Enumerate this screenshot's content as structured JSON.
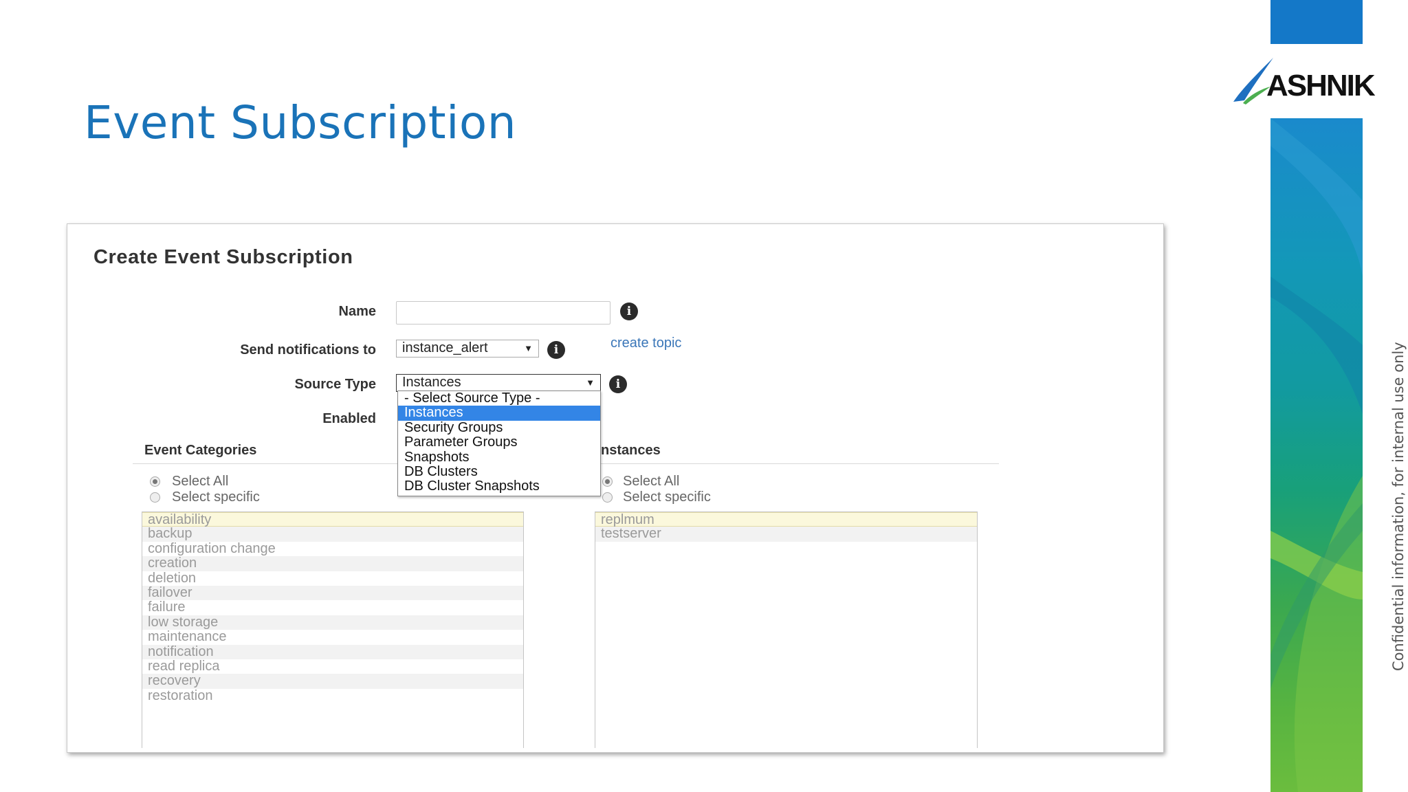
{
  "slide": {
    "title": "Event Subscription",
    "confidential_note": "Confidential information, for internal use only"
  },
  "logo": {
    "text": "ASHNIK"
  },
  "colors": {
    "title_blue": "#1a73b8",
    "link_blue": "#3a76b8",
    "dropdown_selected": "#3385e6",
    "strip_top": "#1478c8",
    "strip_bottom": "#6bbd3e"
  },
  "form": {
    "heading": "Create Event Subscription",
    "name_label": "Name",
    "name_value": "",
    "notify_label": "Send notifications to",
    "notify_value": "instance_alert",
    "create_topic_link": "create topic",
    "source_type_label": "Source Type",
    "source_type_value": "Instances",
    "enabled_label": "Enabled",
    "source_type_options": [
      "- Select Source Type -",
      "Instances",
      "Security Groups",
      "Parameter Groups",
      "Snapshots",
      "DB Clusters",
      "DB Cluster Snapshots"
    ],
    "source_type_selected_index": 1
  },
  "event_categories": {
    "heading": "Event Categories",
    "select_all": "Select All",
    "select_specific": "Select specific",
    "selected_radio": "Select All",
    "items": [
      "availability",
      "backup",
      "configuration change",
      "creation",
      "deletion",
      "failover",
      "failure",
      "low storage",
      "maintenance",
      "notification",
      "read replica",
      "recovery",
      "restoration"
    ]
  },
  "instances": {
    "heading": "nstances",
    "select_all": "Select All",
    "select_specific": "Select specific",
    "selected_radio": "Select All",
    "items": [
      "replmum",
      "testserver"
    ]
  },
  "icons": {
    "info": "info-icon",
    "caret": "caret-down-icon"
  }
}
